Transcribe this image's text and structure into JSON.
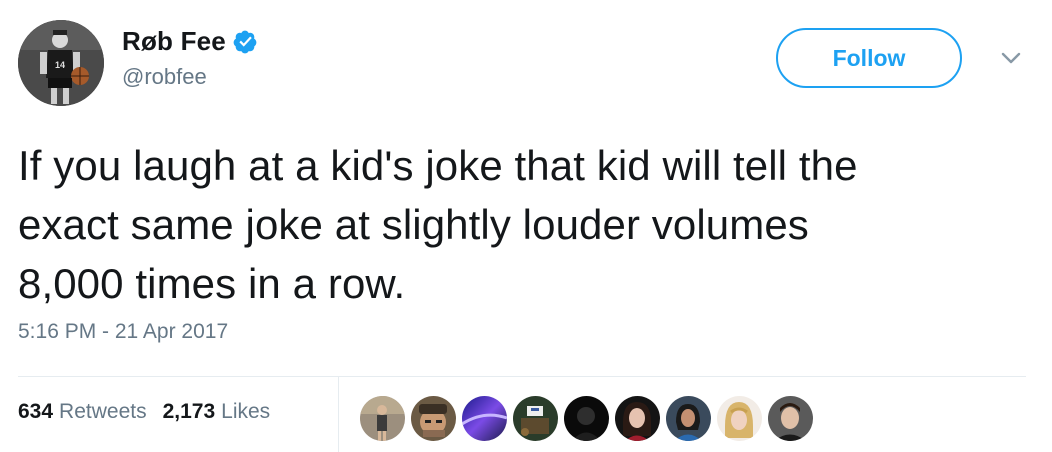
{
  "user": {
    "display_name": "Røb Fee",
    "handle": "@robfee",
    "verified": true,
    "avatar_icon": "avatar-basketball-kid-icon"
  },
  "actions": {
    "follow_label": "Follow",
    "more_icon": "chevron-down-icon"
  },
  "tweet": {
    "lines": [
      "If you laugh at a kid's joke that kid will tell the",
      "exact same joke at slightly louder volumes",
      "8,000 times in a row."
    ],
    "timestamp": "5:16 PM - 21 Apr 2017"
  },
  "stats": {
    "retweets_count": "634",
    "retweets_label": "Retweets",
    "likes_count": "2,173",
    "likes_label": "Likes"
  },
  "likers": [
    {
      "icon": "liker-avatar-1"
    },
    {
      "icon": "liker-avatar-2"
    },
    {
      "icon": "liker-avatar-3"
    },
    {
      "icon": "liker-avatar-4"
    },
    {
      "icon": "liker-avatar-5"
    },
    {
      "icon": "liker-avatar-6"
    },
    {
      "icon": "liker-avatar-7"
    },
    {
      "icon": "liker-avatar-8"
    },
    {
      "icon": "liker-avatar-9"
    }
  ],
  "colors": {
    "accent": "#1da1f2",
    "text": "#14171a",
    "muted": "#657786",
    "divider": "#e6ecf0"
  }
}
